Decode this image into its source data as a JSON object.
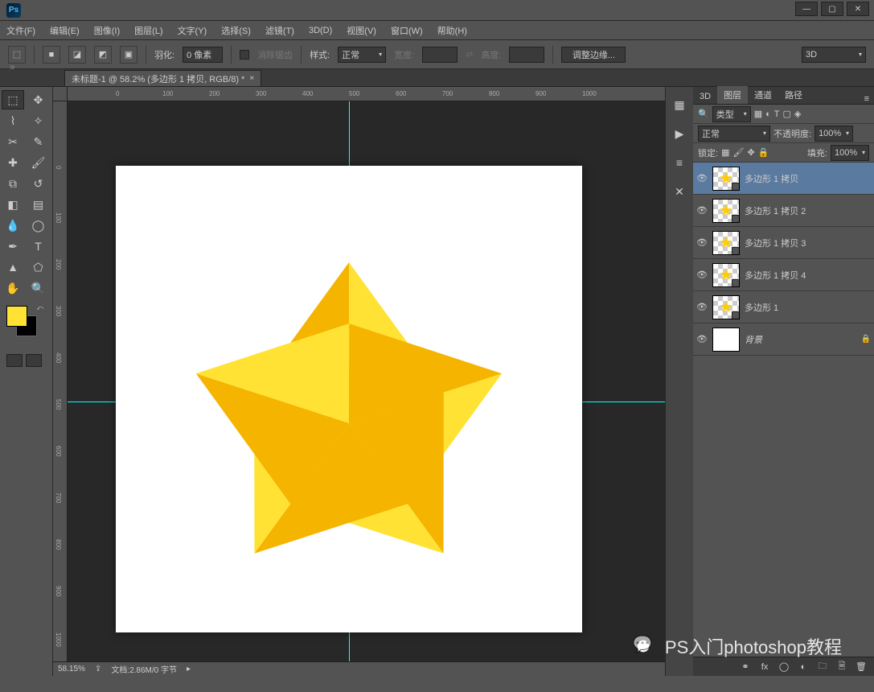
{
  "app": {
    "logo_text": "Ps"
  },
  "window_controls": {
    "min": "—",
    "max": "▢",
    "close": "✕"
  },
  "menu": [
    "文件(F)",
    "编辑(E)",
    "图像(I)",
    "图层(L)",
    "文字(Y)",
    "选择(S)",
    "滤镜(T)",
    "3D(D)",
    "视图(V)",
    "窗口(W)",
    "帮助(H)"
  ],
  "options": {
    "feather_label": "羽化:",
    "feather_value": "0 像素",
    "antialias_label": "消除锯齿",
    "style_label": "样式:",
    "style_value": "正常",
    "width_label": "宽度:",
    "height_label": "高度:",
    "refine_edge": "调整边缘...",
    "workspace": "3D"
  },
  "document": {
    "tab_title": "未标题-1 @ 58.2% (多边形 1 拷贝, RGB/8) *",
    "zoom": "58.15%",
    "info": "文档:2.86M/0 字节"
  },
  "ruler_h": [
    "0",
    "100",
    "200",
    "300",
    "400",
    "500",
    "600",
    "700",
    "800",
    "900",
    "1000"
  ],
  "ruler_v": [
    "0",
    "100",
    "200",
    "300",
    "400",
    "500",
    "600",
    "700",
    "800",
    "900",
    "1000"
  ],
  "panels": {
    "tabs": [
      "3D",
      "图层",
      "通道",
      "路径"
    ],
    "filter_label": "类型",
    "blend_mode": "正常",
    "opacity_label": "不透明度:",
    "opacity_value": "100%",
    "lock_label": "锁定:",
    "fill_label": "填充:",
    "fill_value": "100%"
  },
  "layers": [
    {
      "name": "多边形 1 拷贝",
      "visible": true,
      "star": true,
      "selected": true,
      "shape": true
    },
    {
      "name": "多边形 1 拷贝 2",
      "visible": true,
      "star": true,
      "shape": true
    },
    {
      "name": "多边形 1 拷贝 3",
      "visible": true,
      "star": true,
      "shape": true
    },
    {
      "name": "多边形 1 拷贝 4",
      "visible": true,
      "star": true,
      "shape": true
    },
    {
      "name": "多边形 1",
      "visible": true,
      "star": true,
      "shape": true
    },
    {
      "name": "背景",
      "visible": true,
      "locked": true,
      "italic": true
    }
  ],
  "watermark": "PS入门photoshop教程",
  "colors": {
    "fg": "#ffe234",
    "star_light": "#ffe234",
    "star_dark": "#f5b400"
  }
}
